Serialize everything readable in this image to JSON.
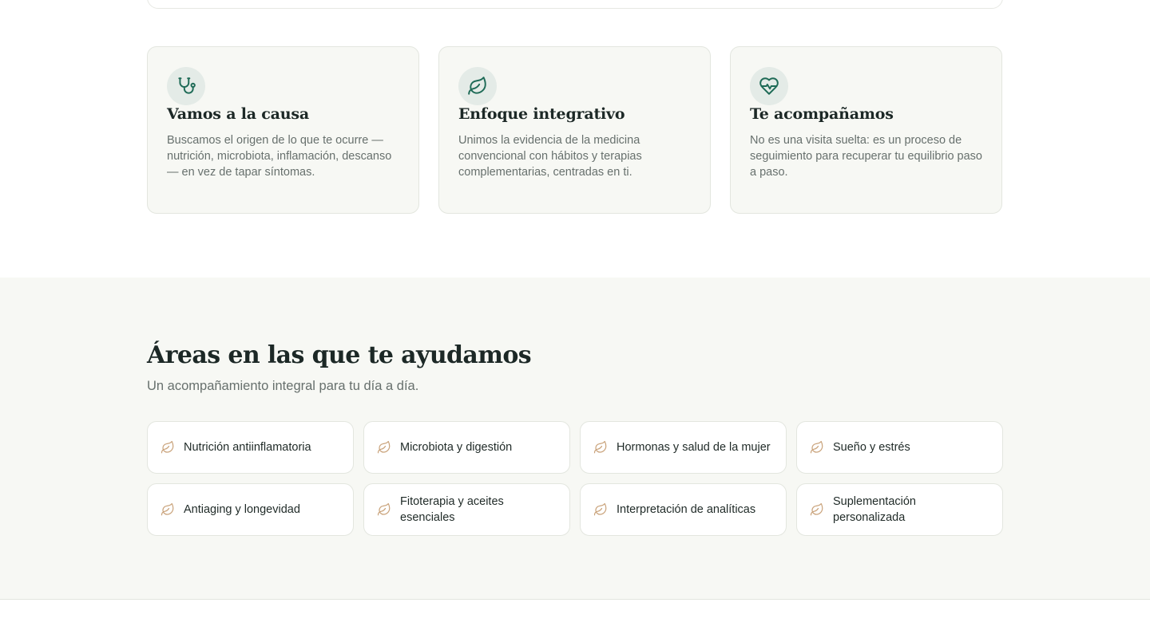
{
  "features": [
    {
      "icon": "stethoscope-icon",
      "title": "Vamos a la causa",
      "text": "Buscamos el origen de lo que te ocurre — nutrición, microbiota, inflamación, descanso— en vez de tapar síntomas."
    },
    {
      "icon": "leaf-icon",
      "title": "Enfoque integrativo",
      "text": "Unimos la evidencia de la medicina convencional con hábitos y terapias complementarias, centradas en ti."
    },
    {
      "icon": "heart-pulse-icon",
      "title": "Te acompañamos",
      "text": "No es una visita suelta: es un proceso de seguimiento para recuperar tu equilibrio paso a paso."
    }
  ],
  "areas": {
    "title": "Áreas en las que te ayudamos",
    "subtitle": "Un acompañamiento integral para tu día a día.",
    "items": [
      "Nutrición antiinflamatoria",
      "Microbiota y digestión",
      "Hormonas y salud de la mujer",
      "Sueño y estrés",
      "Antiaging y longevidad",
      "Fitoterapia y aceites esenciales",
      "Interpretación de analíticas",
      "Suplementación personalizada"
    ]
  },
  "colors": {
    "primary_green": "#1f6b57",
    "accent_gold": "#c9a27a",
    "section_bg": "#f7f8f4"
  }
}
